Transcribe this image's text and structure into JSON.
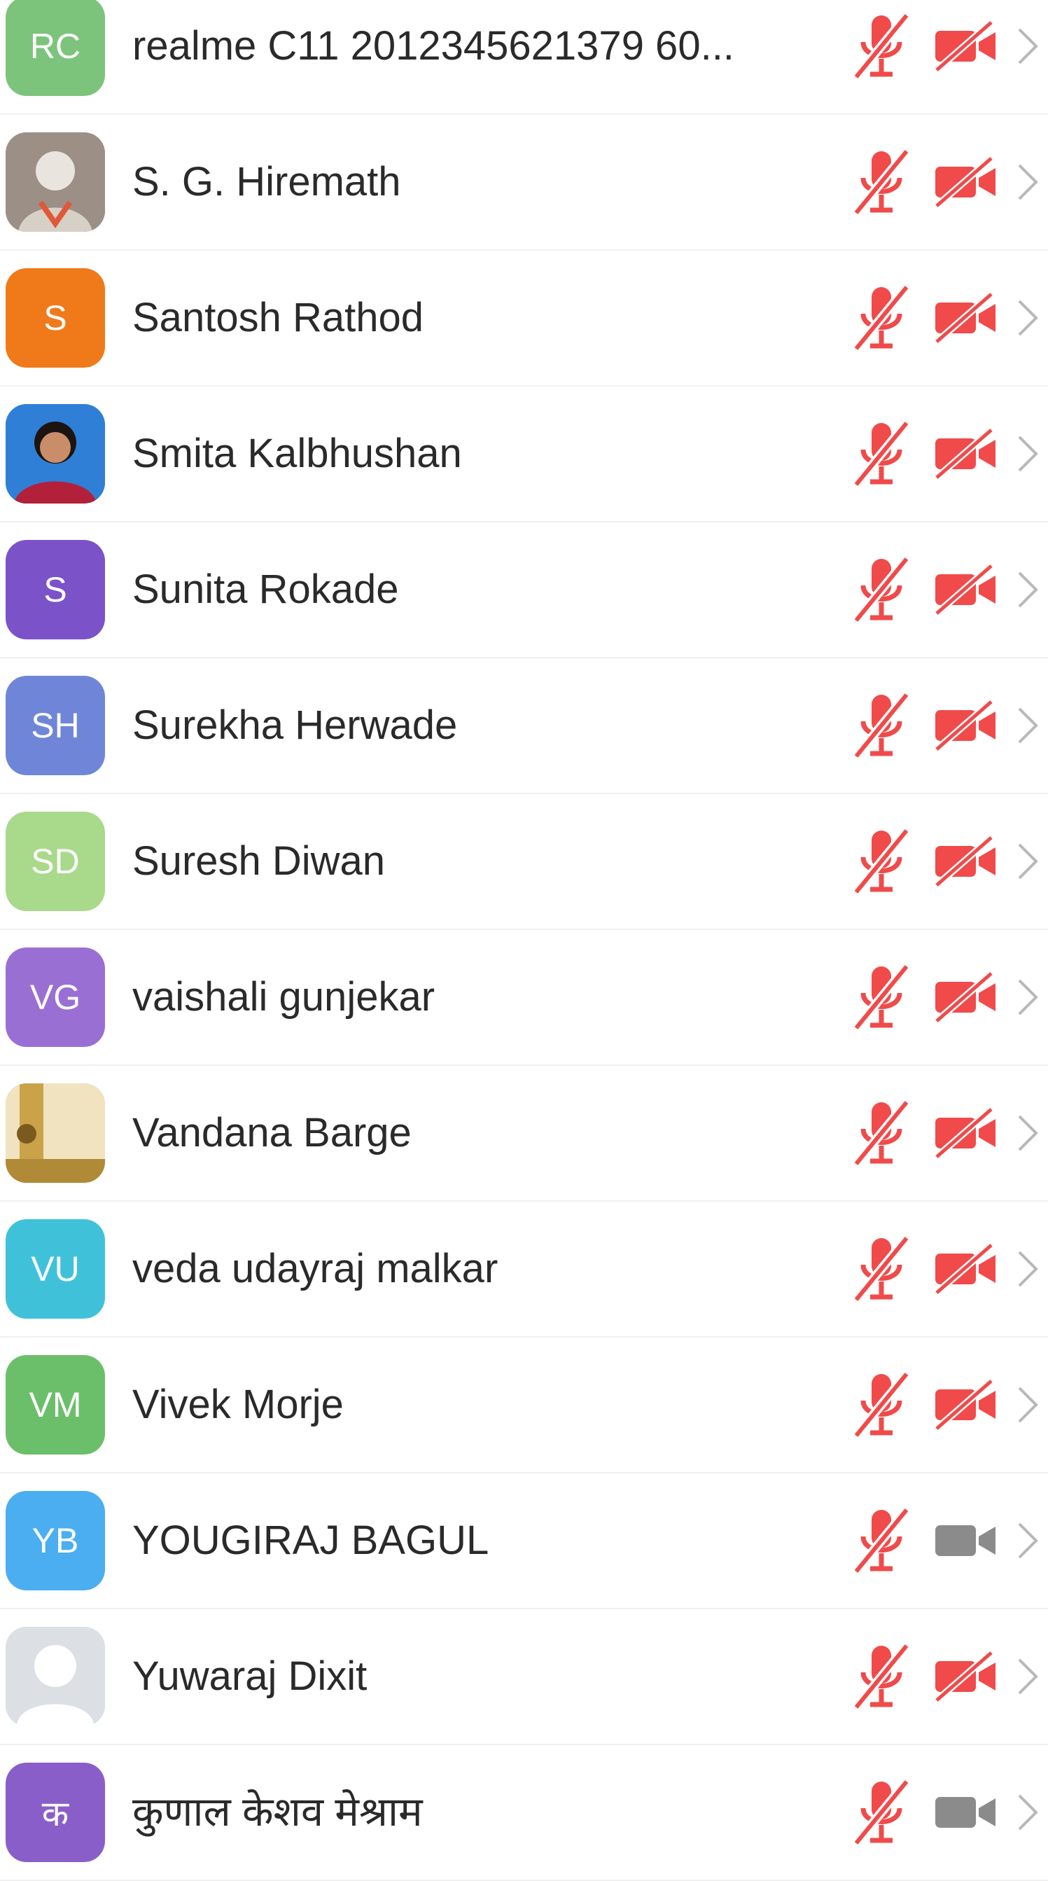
{
  "participants": [
    {
      "initials": "RC",
      "name": "realme C11 2012345621379 60...",
      "avatar_color": "#7cc47b",
      "avatar_type": "initials",
      "video_muted": true
    },
    {
      "initials": "",
      "name": "S. G. Hiremath",
      "avatar_color": "#9b8f86",
      "avatar_type": "photo-elder-icon",
      "video_muted": true
    },
    {
      "initials": "S",
      "name": "Santosh Rathod",
      "avatar_color": "#f07a1a",
      "avatar_type": "initials",
      "video_muted": true
    },
    {
      "initials": "",
      "name": "Smita Kalbhushan",
      "avatar_color": "#2f7fd6",
      "avatar_type": "photo-woman-icon",
      "video_muted": true
    },
    {
      "initials": "S",
      "name": "Sunita Rokade",
      "avatar_color": "#7b52c8",
      "avatar_type": "initials",
      "video_muted": true
    },
    {
      "initials": "SH",
      "name": "Surekha Herwade",
      "avatar_color": "#6f86d8",
      "avatar_type": "initials",
      "video_muted": true
    },
    {
      "initials": "SD",
      "name": "Suresh Diwan",
      "avatar_color": "#a9d98b",
      "avatar_type": "initials",
      "video_muted": true
    },
    {
      "initials": "VG",
      "name": "vaishali gunjekar",
      "avatar_color": "#9a6fd4",
      "avatar_type": "initials",
      "video_muted": true
    },
    {
      "initials": "",
      "name": "Vandana Barge",
      "avatar_color": "#c9a24a",
      "avatar_type": "photo-gold-icon",
      "video_muted": true
    },
    {
      "initials": "VU",
      "name": "veda udayraj malkar",
      "avatar_color": "#3fc2d9",
      "avatar_type": "initials",
      "video_muted": true
    },
    {
      "initials": "VM",
      "name": "Vivek Morje",
      "avatar_color": "#6cbf6a",
      "avatar_type": "initials",
      "video_muted": true
    },
    {
      "initials": "YB",
      "name": "YOUGIRAJ BAGUL",
      "avatar_color": "#4aaef0",
      "avatar_type": "initials",
      "video_muted": false
    },
    {
      "initials": "",
      "name": "Yuwaraj Dixit",
      "avatar_color": "#dcdfe3",
      "avatar_type": "default-user-icon",
      "video_muted": true
    },
    {
      "initials": "क",
      "name": "कुणाल  केशव मेश्राम",
      "avatar_color": "#8a5ec9",
      "avatar_type": "initials",
      "video_muted": false
    }
  ],
  "colors": {
    "muted_red": "#f04a4a",
    "video_on_gray": "#8b8b8b",
    "chevron_gray": "#b8b8b8",
    "text": "#2a2a2a"
  },
  "icons": {
    "mic": "mic-muted-icon",
    "video_off": "video-off-icon",
    "video_on": "video-camera-icon",
    "chevron": "chevron-right-icon"
  }
}
